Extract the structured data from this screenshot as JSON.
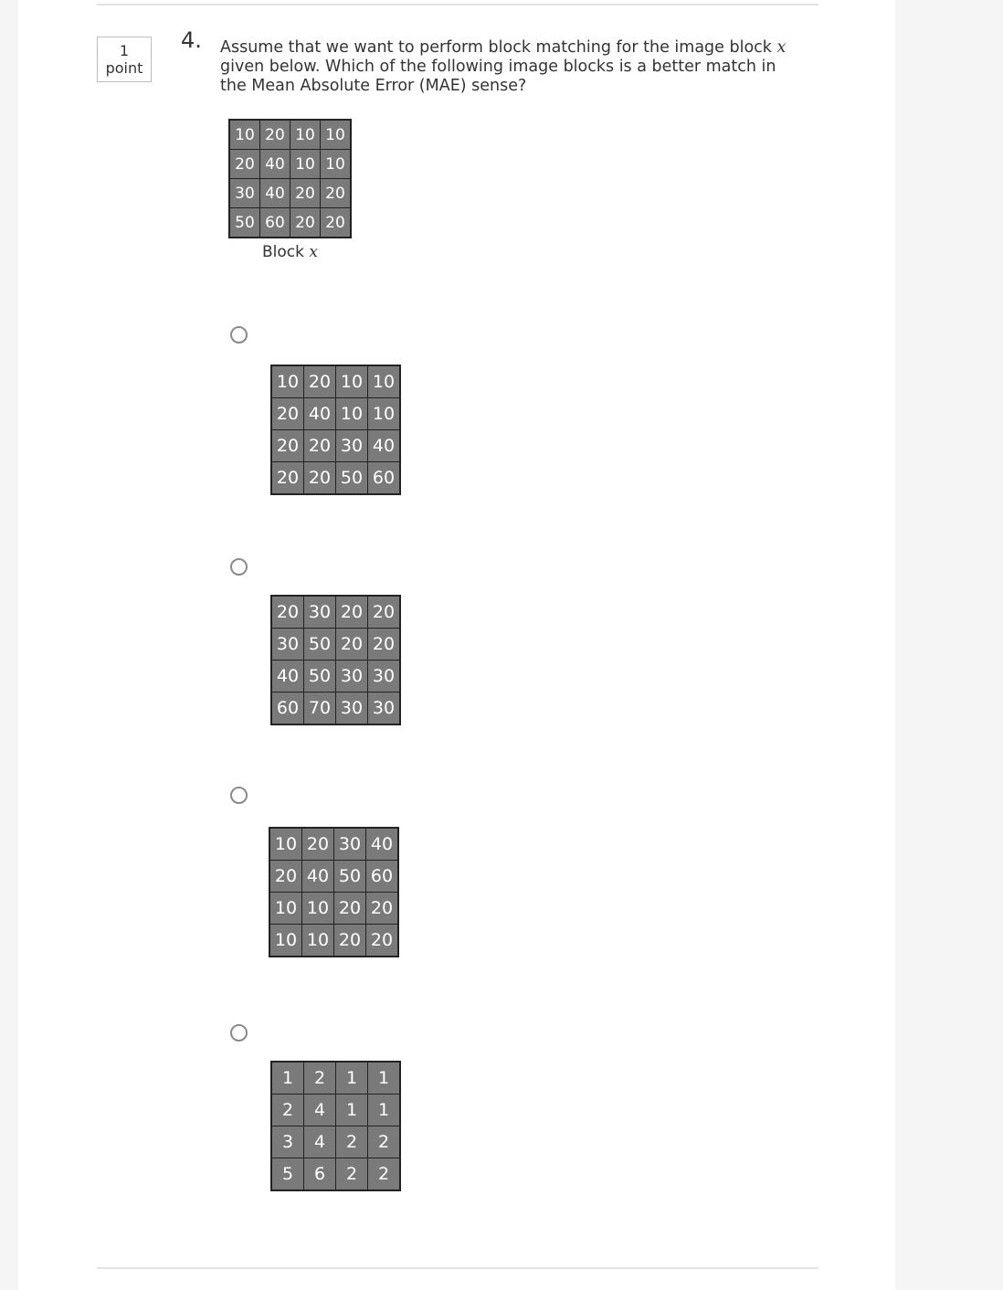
{
  "question": {
    "points_value": "1",
    "points_unit": "point",
    "number": "4.",
    "text_before_var": "Assume that we want to perform block matching for the image block ",
    "text_var": "x",
    "text_after_var": " given below. Which of the following image blocks is a better match in the Mean Absolute Error (MAE) sense?",
    "block_label_prefix": "Block ",
    "block_label_var": "x",
    "block_x": [
      [
        "10",
        "20",
        "10",
        "10"
      ],
      [
        "20",
        "40",
        "10",
        "10"
      ],
      [
        "30",
        "40",
        "20",
        "20"
      ],
      [
        "50",
        "60",
        "20",
        "20"
      ]
    ]
  },
  "options": [
    {
      "selected": false,
      "grid": [
        [
          "10",
          "20",
          "10",
          "10"
        ],
        [
          "20",
          "40",
          "10",
          "10"
        ],
        [
          "20",
          "20",
          "30",
          "40"
        ],
        [
          "20",
          "20",
          "50",
          "60"
        ]
      ]
    },
    {
      "selected": false,
      "grid": [
        [
          "20",
          "30",
          "20",
          "20"
        ],
        [
          "30",
          "50",
          "20",
          "20"
        ],
        [
          "40",
          "50",
          "30",
          "30"
        ],
        [
          "60",
          "70",
          "30",
          "30"
        ]
      ]
    },
    {
      "selected": false,
      "grid": [
        [
          "10",
          "20",
          "30",
          "40"
        ],
        [
          "20",
          "40",
          "50",
          "60"
        ],
        [
          "10",
          "10",
          "20",
          "20"
        ],
        [
          "10",
          "10",
          "20",
          "20"
        ]
      ]
    },
    {
      "selected": false,
      "grid": [
        [
          "1",
          "2",
          "1",
          "1"
        ],
        [
          "2",
          "4",
          "1",
          "1"
        ],
        [
          "3",
          "4",
          "2",
          "2"
        ],
        [
          "5",
          "6",
          "2",
          "2"
        ]
      ]
    }
  ],
  "colors": {
    "cell_fill": "#7a7a7a",
    "cell_text": "#ffffff",
    "cell_border": "#222222",
    "page_bg": "#ffffff",
    "outer_bg": "#f5f5f5"
  }
}
